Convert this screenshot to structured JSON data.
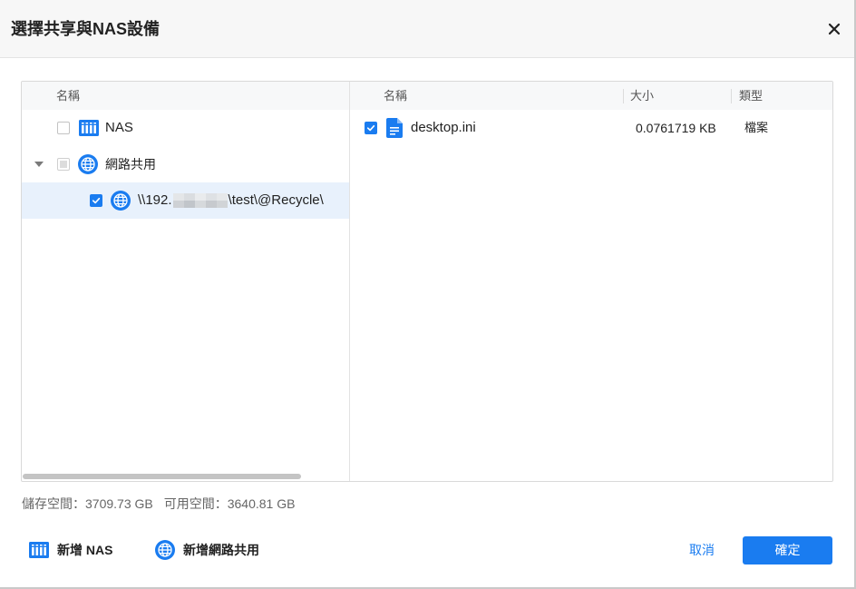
{
  "window": {
    "title": "選擇共享與NAS設備",
    "close_icon": "close-icon"
  },
  "tree": {
    "header": "名稱",
    "expander_icon": "chevron-down-icon",
    "items": [
      {
        "label": "NAS",
        "icon": "nas-icon",
        "checked": false,
        "indeterminate": false
      },
      {
        "label": "網路共用",
        "icon": "globe-icon",
        "checked": false,
        "indeterminate": true,
        "expanded": true
      },
      {
        "label_prefix": "\\\\192.",
        "label_suffix": "\\test\\@Recycle\\",
        "icon": "globe-icon",
        "checked": true,
        "indeterminate": false,
        "selected": true
      }
    ]
  },
  "files": {
    "columns": {
      "name": "名稱",
      "size": "大小",
      "type": "類型"
    },
    "rows": [
      {
        "name": "desktop.ini",
        "size": "0.0761719 KB",
        "type": "檔案",
        "icon": "file-icon",
        "checked": true
      }
    ]
  },
  "storage": {
    "total": "儲存空間：3709.73 GB",
    "available": "可用空間：3640.81 GB"
  },
  "footer": {
    "add_nas_label": "新增 NAS",
    "add_nas_icon": "nas-icon",
    "add_share_label": "新增網路共用",
    "add_share_icon": "globe-icon",
    "cancel_label": "取消",
    "confirm_label": "確定"
  },
  "colors": {
    "accent": "#1a7cf0",
    "selected_row": "#e8f1fc"
  }
}
